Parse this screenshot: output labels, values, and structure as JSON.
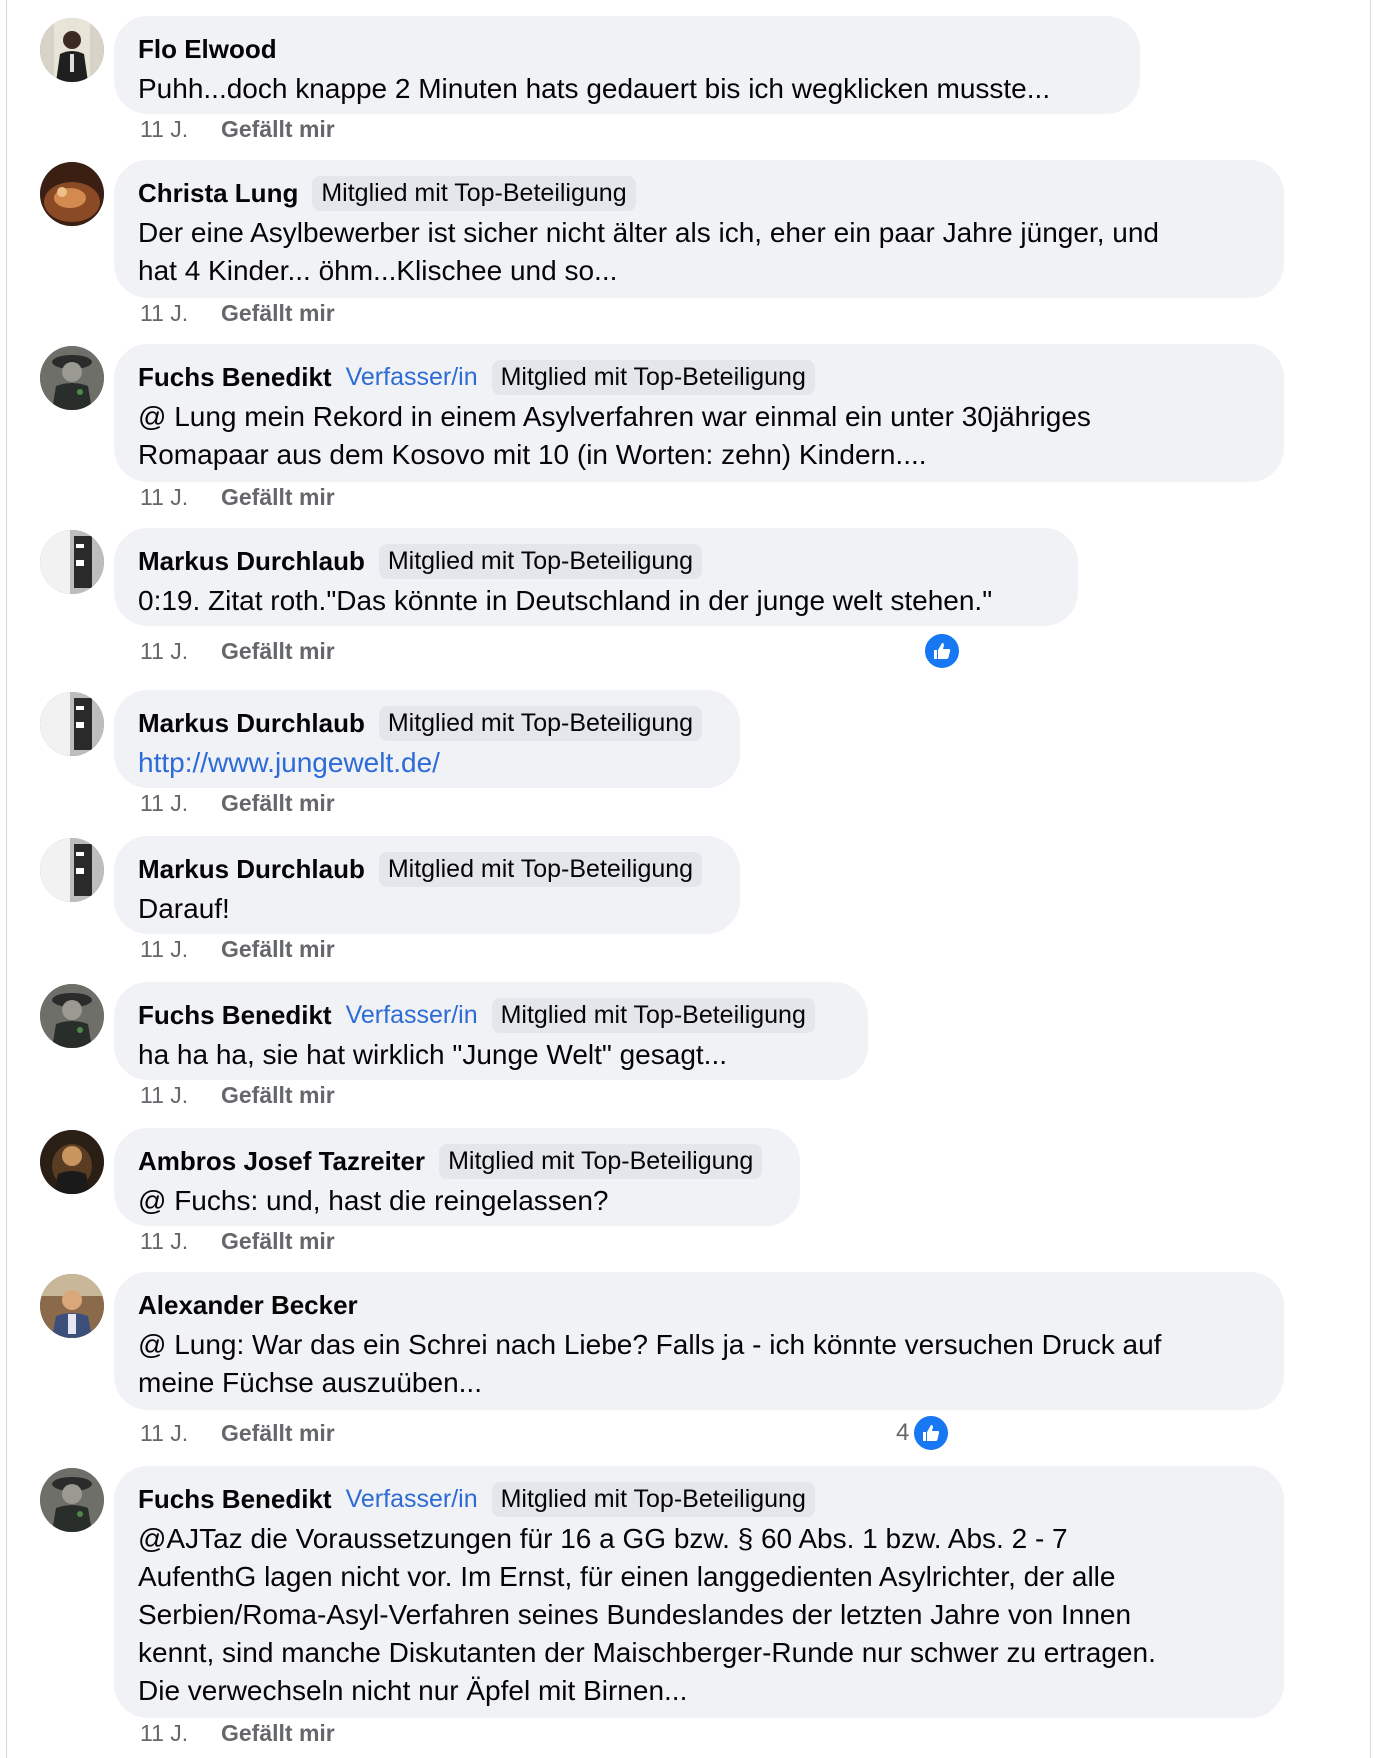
{
  "comments": [
    {
      "name": "Flo Elwood",
      "author_tag": "",
      "badge": "",
      "text": "Puhh...doch knappe 2 Minuten hats gedauert bis ich wegklicken musste...",
      "time": "11 J.",
      "like": "Gefällt mir",
      "reaction_count": ""
    },
    {
      "name": "Christa Lung",
      "author_tag": "",
      "badge": "Mitglied mit Top-Beteiligung",
      "text_lines": [
        "Der eine Asylbewerber ist sicher nicht älter als ich, eher ein paar Jahre jünger, und",
        "hat 4 Kinder... öhm...Klischee und so..."
      ],
      "time": "11 J.",
      "like": "Gefällt mir",
      "reaction_count": ""
    },
    {
      "name": "Fuchs Benedikt",
      "author_tag": "Verfasser/in",
      "badge": "Mitglied mit Top-Beteiligung",
      "text_lines": [
        "@ Lung mein Rekord in einem Asylverfahren war einmal ein unter 30jähriges",
        "Romapaar aus dem Kosovo mit 10 (in Worten: zehn) Kindern...."
      ],
      "time": "11 J.",
      "like": "Gefällt mir",
      "reaction_count": ""
    },
    {
      "name": "Markus Durchlaub",
      "author_tag": "",
      "badge": "Mitglied mit Top-Beteiligung",
      "text": "0:19. Zitat roth.\"Das könnte in Deutschland in der junge welt stehen.\"",
      "time": "11 J.",
      "like": "Gefällt mir",
      "reaction_count": ""
    },
    {
      "name": "Markus Durchlaub",
      "author_tag": "",
      "badge": "Mitglied mit Top-Beteiligung",
      "text": "http://www.jungewelt.de/",
      "time": "11 J.",
      "like": "Gefällt mir",
      "reaction_count": ""
    },
    {
      "name": "Markus Durchlaub",
      "author_tag": "",
      "badge": "Mitglied mit Top-Beteiligung",
      "text": "Darauf!",
      "time": "11 J.",
      "like": "Gefällt mir",
      "reaction_count": ""
    },
    {
      "name": "Fuchs Benedikt",
      "author_tag": "Verfasser/in",
      "badge": "Mitglied mit Top-Beteiligung",
      "text": "ha ha ha, sie hat wirklich \"Junge Welt\" gesagt...",
      "time": "11 J.",
      "like": "Gefällt mir",
      "reaction_count": ""
    },
    {
      "name": "Ambros Josef Tazreiter",
      "author_tag": "",
      "badge": "Mitglied mit Top-Beteiligung",
      "text": "@ Fuchs: und, hast die reingelassen?",
      "time": "11 J.",
      "like": "Gefällt mir",
      "reaction_count": ""
    },
    {
      "name": "Alexander Becker",
      "author_tag": "",
      "badge": "",
      "text_lines": [
        "@ Lung: War das ein Schrei nach Liebe? Falls ja - ich könnte versuchen Druck auf",
        "meine Füchse auszuüben..."
      ],
      "time": "11 J.",
      "like": "Gefällt mir",
      "reaction_count": "4"
    },
    {
      "name": "Fuchs Benedikt",
      "author_tag": "Verfasser/in",
      "badge": "Mitglied mit Top-Beteiligung",
      "text_lines": [
        "@AJTaz die Voraussetzungen für 16 a GG bzw. § 60 Abs. 1 bzw. Abs. 2 - 7",
        "AufenthG lagen nicht vor. Im Ernst, für einen langgedienten Asylrichter, der alle",
        "Serbien/Roma-Asyl-Verfahren seines Bundeslandes der letzten Jahre von Innen",
        "kennt, sind manche Diskutanten der Maischberger-Runde nur schwer zu ertragen.",
        "Die verwechseln nicht nur Äpfel mit Birnen..."
      ],
      "time": "11 J.",
      "like": "Gefällt mir",
      "reaction_count": ""
    }
  ],
  "colors": {
    "bubble": "#f0f2f5",
    "badge": "#e4e6eb",
    "author_tag": "#2d6bd6",
    "link": "#2d6bd6",
    "meta": "#65676b",
    "reaction": "#1877f2"
  }
}
